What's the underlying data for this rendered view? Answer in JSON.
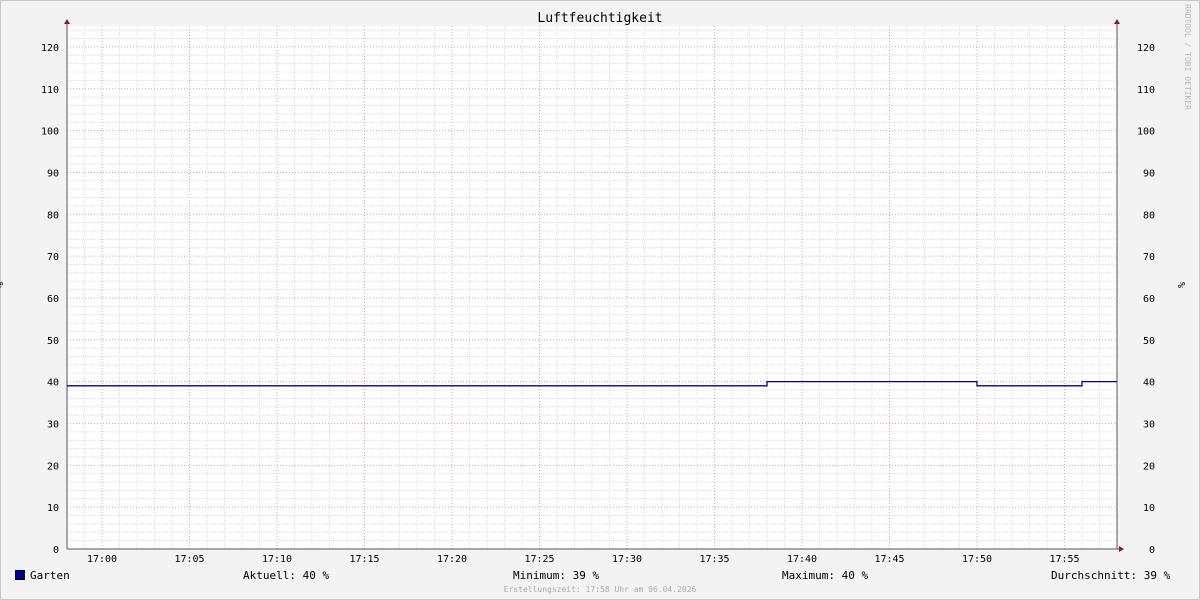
{
  "chart_data": {
    "type": "line",
    "title": "Luftfeuchtigkeit",
    "ylabel": "%",
    "ylim": [
      0,
      125
    ],
    "yticks": [
      0,
      10,
      20,
      30,
      40,
      50,
      60,
      70,
      80,
      90,
      100,
      110,
      120
    ],
    "xlim": [
      "16:58",
      "17:58"
    ],
    "xticks": [
      "17:00",
      "17:05",
      "17:10",
      "17:15",
      "17:20",
      "17:25",
      "17:30",
      "17:35",
      "17:40",
      "17:45",
      "17:50",
      "17:55"
    ],
    "grid": true,
    "series": [
      {
        "name": "Garten",
        "color": "#000099",
        "x": [
          "16:58",
          "17:38",
          "17:38",
          "17:50",
          "17:50",
          "17:56",
          "17:56",
          "17:58"
        ],
        "y": [
          39,
          39,
          40,
          40,
          39,
          39,
          40,
          40
        ]
      }
    ]
  },
  "legend": {
    "series_name": "Garten",
    "aktuell": "Aktuell:  40 %",
    "minimum": "Minimum:  39 %",
    "maximum": "Maximum:  40 %",
    "durchschnitt": "Durchschnitt:  39 %"
  },
  "watermark": "RRDTOOL / TOBI OETIKER",
  "created": "Erstellungszeit: 17:58 Uhr am 06.04.2026",
  "colors": {
    "background": "#f3f3f3",
    "plot": "#ffffff",
    "minor_grid": "#dcdcdc",
    "major_grid": "#e8a0a0",
    "axis": "#555555",
    "arrow": "#8b1a1a"
  }
}
